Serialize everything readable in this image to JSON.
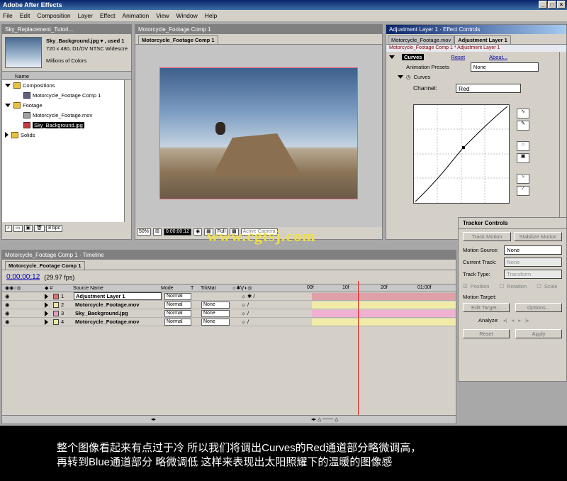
{
  "app": {
    "title": "Adobe After Effects"
  },
  "menu": [
    "File",
    "Edit",
    "Composition",
    "Layer",
    "Effect",
    "Animation",
    "View",
    "Window",
    "Help"
  ],
  "project": {
    "title": "Sky_Replacement_Tutori...",
    "file_name": "Sky_Background.jpg ▾ , used 1",
    "file_info": "720 x 480, D1/DV NTSC Widescre",
    "file_colors": "Millions of Colors",
    "col_name": "Name",
    "items": [
      {
        "label": "Compositions",
        "type": "folder",
        "indent": 0,
        "open": true
      },
      {
        "label": "Motorcycle_Footage Comp 1",
        "type": "comp",
        "indent": 1
      },
      {
        "label": "Footage",
        "type": "folder",
        "indent": 0,
        "open": true
      },
      {
        "label": "Motorcycle_Footage.mov",
        "type": "file",
        "indent": 1
      },
      {
        "label": "Sky_Background.jpg",
        "type": "file",
        "indent": 1,
        "selected": true
      },
      {
        "label": "Solids",
        "type": "folder",
        "indent": 0,
        "open": false
      }
    ],
    "bpc": "8 bpc"
  },
  "comp": {
    "title": "Motorcycle_Footage Comp 1",
    "tab": "Motorcycle_Footage Comp 1",
    "zoom": "50%",
    "time": "0;00;00;12",
    "res": "Full",
    "camera": "Active Camera"
  },
  "effects": {
    "title": "Adjustment Layer 1 · Effect Controls",
    "tab_inactive": "Motorcycle_Footage.mov",
    "tab_active": "Adjustment Layer 1",
    "breadcrumb": "Motorcycle_Footage Comp 1 * Adjustment Layer 1",
    "effect_name": "Curves",
    "reset": "Reset",
    "about": "About...",
    "presets_label": "Animation Presets",
    "presets_value": "None",
    "curves_label": "Curves",
    "channel_label": "Channel:",
    "channel_value": "Red"
  },
  "timeline": {
    "title": "Motorcycle_Footage Comp 1 · Timeline",
    "tab": "Motorcycle_Footage Comp 1",
    "time": "0;00;00;12",
    "fps": "(29.97 fps)",
    "headers": {
      "source": "Source Name",
      "mode": "Mode",
      "t": "T",
      "trkmat": "TrkMat"
    },
    "ruler": [
      "00f",
      "10f",
      "20f",
      "01:00f"
    ],
    "layers": [
      {
        "num": "1",
        "name": "Adjustment Layer 1",
        "color": "#e07070",
        "mode": "Normal",
        "trk": "",
        "bar": "#e0a0a8"
      },
      {
        "num": "2",
        "name": "Motorcycle_Footage.mov",
        "color": "#e8e8a0",
        "mode": "Normal",
        "trk": "None",
        "bar": "#f0eca8"
      },
      {
        "num": "3",
        "name": "Sky_Background.jpg",
        "color": "#e0a0c0",
        "mode": "Normal",
        "trk": "None",
        "bar": "#f0b0d0"
      },
      {
        "num": "4",
        "name": "Motorcycle_Footage.mov",
        "color": "#e8e8a0",
        "mode": "Normal",
        "trk": "None",
        "bar": "#f0eca8"
      }
    ]
  },
  "tracker": {
    "title": "Tracker Controls",
    "track_motion": "Track Motion",
    "stabilize_motion": "Stabilize Motion",
    "motion_source_label": "Motion Source:",
    "motion_source": "None",
    "current_track_label": "Current Track:",
    "current_track": "None",
    "track_type_label": "Track Type:",
    "track_type": "Transform",
    "position": "Position",
    "rotation": "Rotation",
    "scale": "Scale",
    "motion_target_label": "Motion Target:",
    "edit_target": "Edit Target...",
    "options": "Options...",
    "analyze_label": "Analyze:",
    "reset": "Reset",
    "apply": "Apply"
  },
  "watermark": "www.cgtsj.com",
  "subtitle": {
    "line1": "整个图像看起来有点过于冷 所以我们将调出Curves的Red通道部分略微调高，",
    "line2": "再转到Blue通道部分 略微调低 这样来表现出太阳照耀下的温暖的图像感"
  }
}
